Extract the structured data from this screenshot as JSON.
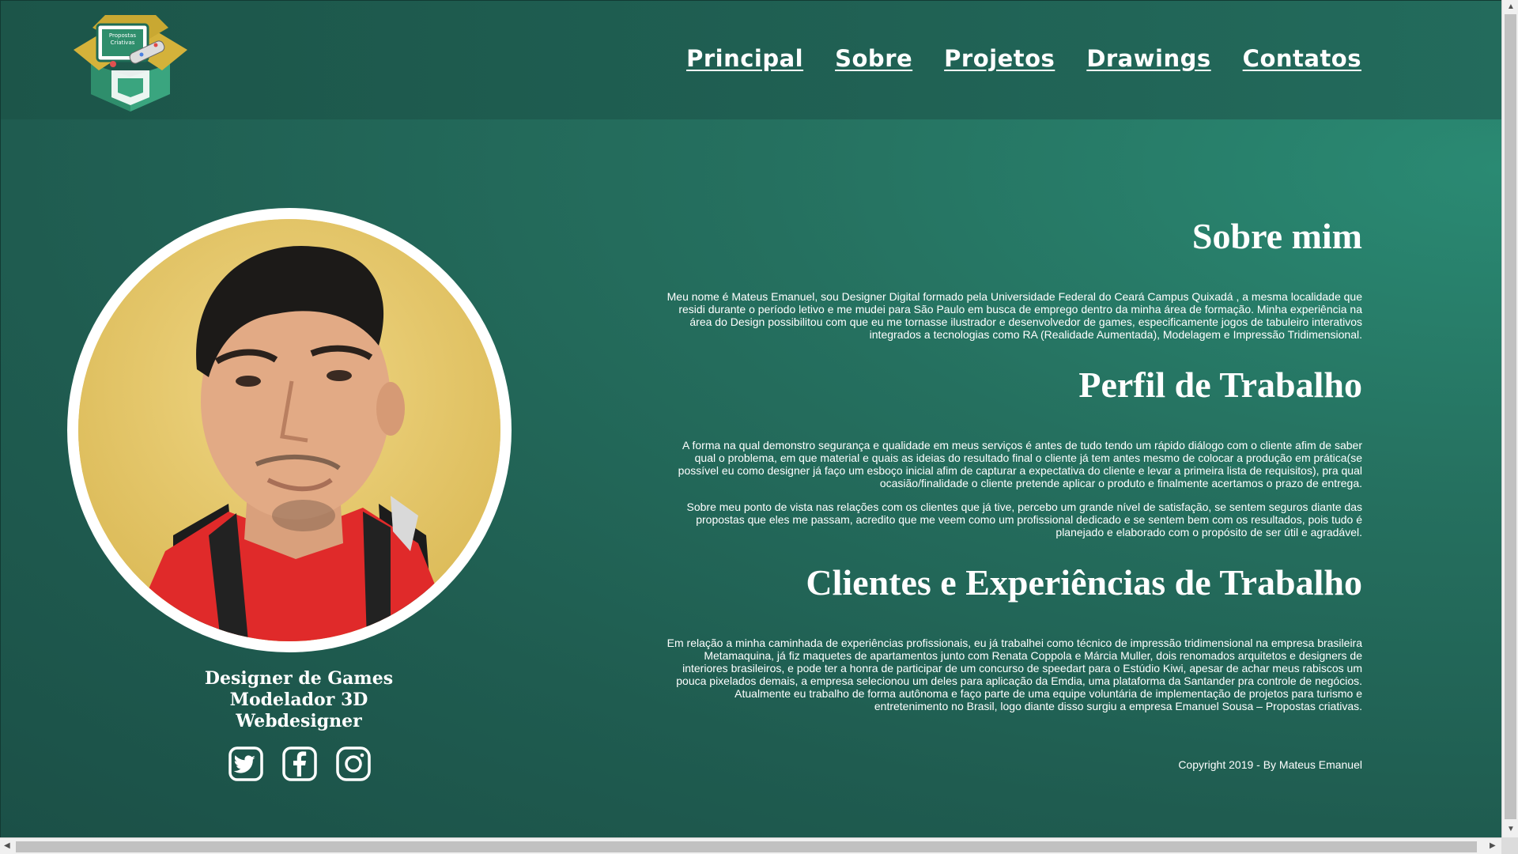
{
  "nav": {
    "items": [
      {
        "label": "Principal"
      },
      {
        "label": "Sobre"
      },
      {
        "label": "Projetos"
      },
      {
        "label": "Drawings"
      },
      {
        "label": "Contatos"
      }
    ]
  },
  "logo": {
    "text_line1": "Propostas",
    "text_line2": "Criativas"
  },
  "profile": {
    "roles": [
      "Designer de Games",
      "Modelador 3D",
      "Webdesigner"
    ],
    "social": [
      {
        "icon": "twitter-icon"
      },
      {
        "icon": "facebook-icon"
      },
      {
        "icon": "instagram-icon"
      }
    ]
  },
  "sections": [
    {
      "title": "Sobre mim",
      "paragraphs": [
        "Meu nome é Mateus Emanuel, sou Designer Digital formado pela Universidade Federal do Ceará Campus Quixadá , a mesma localidade que residi durante o período letivo e me mudei para São Paulo em busca de emprego dentro da minha área de formação. Minha experiência na área do Design possibilitou com que eu me tornasse ilustrador e desenvolvedor de games, especificamente jogos de tabuleiro interativos integrados a tecnologias como RA (Realidade Aumentada), Modelagem e Impressão Tridimensional."
      ]
    },
    {
      "title": "Perfil de Trabalho",
      "paragraphs": [
        "A forma na qual demonstro segurança e qualidade em meus serviços é antes de tudo tendo um rápido diálogo com o cliente afim de saber qual o problema, em que material e quais as ideias do resultado final o cliente já tem antes mesmo de colocar a produção em prática(se possível eu como designer já faço um esboço inicial afim de capturar a expectativa do cliente e levar a primeira lista de requisitos), pra qual ocasião/finalidade o cliente pretende aplicar o produto e finalmente acertamos o prazo de entrega.",
        "Sobre meu ponto de vista nas relações com os clientes que já tive, percebo um grande nível de satisfação, se sentem seguros diante das propostas que eles me passam, acredito que me veem como um profissional dedicado e se sentem bem com os resultados, pois tudo é planejado e elaborado com o propósito de ser útil e agradável."
      ]
    },
    {
      "title": "Clientes e Experiências de Trabalho",
      "paragraphs": [
        "Em relação a minha caminhada de experiências profissionais, eu já trabalhei como técnico de impressão tridimensional na empresa brasileira Metamaquina, já fiz maquetes de apartamentos junto com Renata Coppola e Márcia Muller, dois renomados arquitetos e designers de interiores brasileiros, e pode ter a honra de participar de um concurso de speedart para o Estúdio Kiwi, apesar de achar meus rabiscos um pouca pixelados demais, a empresa selecionou um deles para aplicação da Emdia, uma plataforma da Santander pra controle de negócios. Atualmente eu trabalho de forma autônoma e faço parte de uma equipe voluntária de implementação de projetos para turismo e entretenimento no Brasil, logo diante disso surgiu a empresa Emanuel Sousa – Propostas criativas."
      ]
    }
  ],
  "footer": {
    "copyright": "Copyright 2019 - By Mateus Emanuel"
  }
}
